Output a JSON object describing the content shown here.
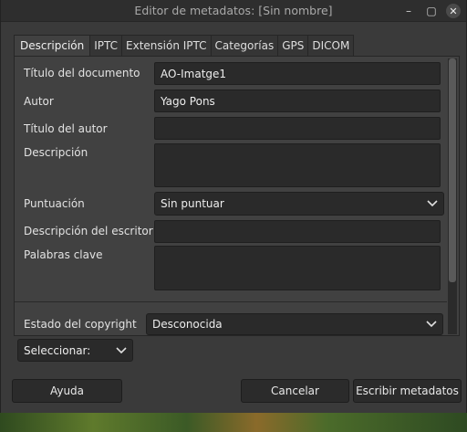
{
  "window": {
    "title": "Editor de metadatos: [Sin nombre]",
    "minimize_glyph": "–",
    "maximize_glyph": "▢",
    "close_glyph": "✕"
  },
  "tabs": [
    {
      "label": "Descripción",
      "active": true
    },
    {
      "label": "IPTC"
    },
    {
      "label": "Extensión IPTC"
    },
    {
      "label": "Categorías"
    },
    {
      "label": "GPS"
    },
    {
      "label": "DICOM"
    }
  ],
  "form": {
    "document_title_label": "Título del documento",
    "document_title_value": "AO-Imatge1",
    "author_label": "Autor",
    "author_value": "Yago Pons",
    "author_title_label": "Título del autor",
    "author_title_value": "",
    "description_label": "Descripción",
    "description_value": "",
    "rating_label": "Puntuación",
    "rating_value": "Sin puntuar",
    "writer_description_label": "Descripción del escritor",
    "writer_description_value": "",
    "keywords_label": "Palabras clave",
    "keywords_value": ""
  },
  "copyright": {
    "label": "Estado del copyright",
    "value": "Desconocida"
  },
  "select_dropdown": {
    "value": "Seleccionar:"
  },
  "buttons": {
    "help": "Ayuda",
    "cancel": "Cancelar",
    "write": "Escribir metadatos"
  },
  "icons": {
    "dropdown": "chevron-down-icon"
  }
}
